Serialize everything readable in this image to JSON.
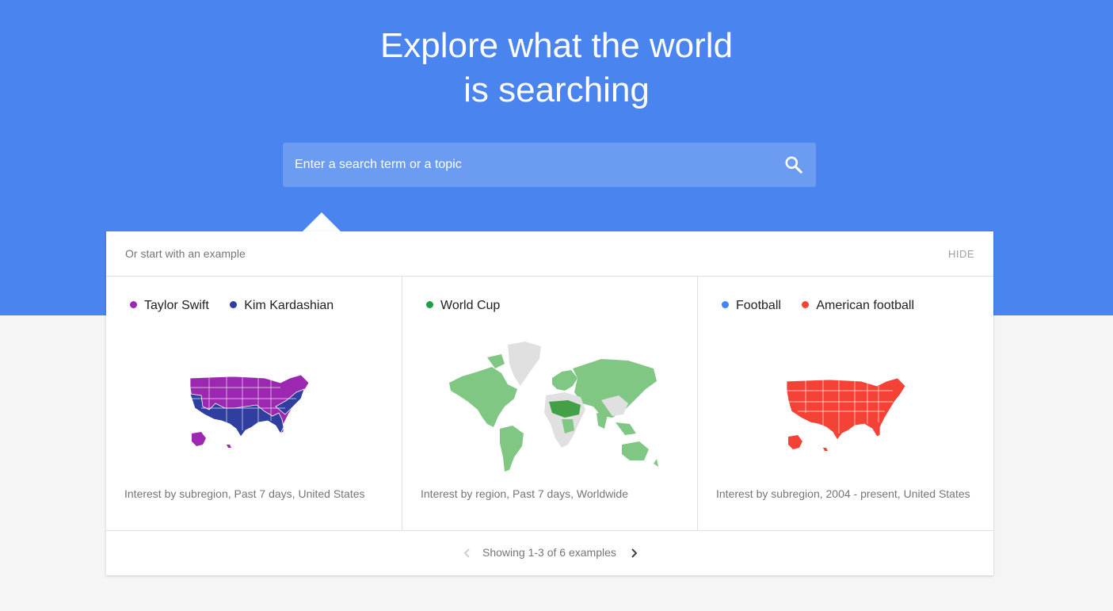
{
  "hero": {
    "title_line1": "Explore what the world",
    "title_line2": "is searching",
    "background_color": "#4a84ef"
  },
  "search": {
    "placeholder": "Enter a search term or a topic",
    "value": "",
    "icon": "search-icon"
  },
  "examples_panel": {
    "subtitle": "Or start with an example",
    "hide_label": "HIDE",
    "examples": [
      {
        "terms": [
          {
            "label": "Taylor Swift",
            "color": "#9c27b0"
          },
          {
            "label": "Kim Kardashian",
            "color": "#303f9f"
          }
        ],
        "map": "United States subregion map",
        "caption": "Interest by subregion, Past 7 days, United States"
      },
      {
        "terms": [
          {
            "label": "World Cup",
            "color": "#1e9e4a"
          }
        ],
        "map": "World region map",
        "caption": "Interest by region, Past 7 days, Worldwide"
      },
      {
        "terms": [
          {
            "label": "Football",
            "color": "#4285f4"
          },
          {
            "label": "American football",
            "color": "#f44336"
          }
        ],
        "map": "United States subregion map",
        "caption": "Interest by subregion, 2004 - present, United States"
      }
    ],
    "pager": {
      "text": "Showing 1-3 of 6 examples",
      "prev_icon": "chevron-left-icon",
      "next_icon": "chevron-right-icon"
    }
  }
}
